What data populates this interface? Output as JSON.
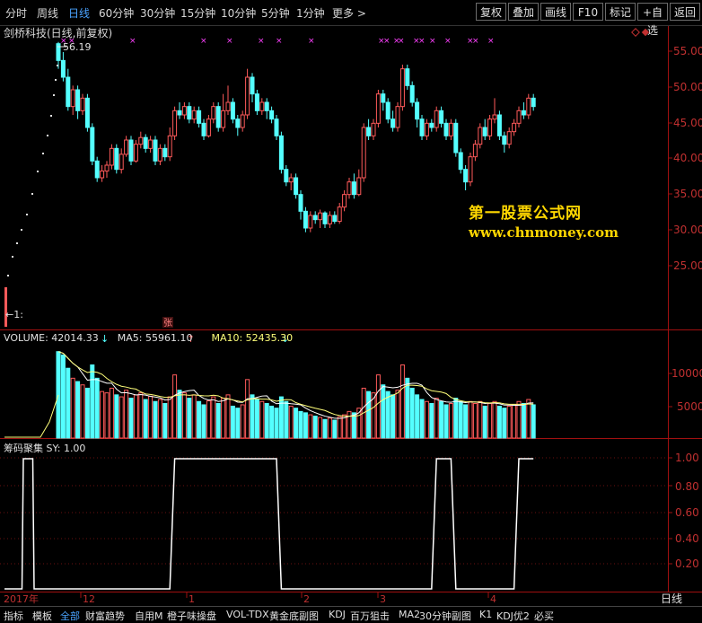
{
  "topbar": {
    "tabs": [
      "分时",
      "周线",
      "日线",
      "60分钟",
      "30分钟",
      "15分钟",
      "10分钟",
      "5分钟",
      "1分钟",
      "更多 >"
    ],
    "active_tab": "日线",
    "right_buttons": [
      "复权",
      "叠加",
      "画线",
      "F10",
      "标记",
      "+自选",
      "返回"
    ]
  },
  "stock": {
    "title": "剑桥科技(日线,前复权)",
    "peak_label": "56.19",
    "left_marker": "←1:",
    "bottom_marker": "张"
  },
  "watermark": {
    "line1": "第一股票公式网",
    "line2": "www.chnmoney.com"
  },
  "volume_header": {
    "label": "VOLUME: 42014.33",
    "ma5": "MA5: 55961.10",
    "ma10": "MA10: 52435.30"
  },
  "sy_header": {
    "label": "筹码聚集  SY: 1.00"
  },
  "price_axis": [
    "55.00",
    "50.00",
    "45.00",
    "40.00",
    "35.00",
    "30.00",
    "25.00"
  ],
  "volume_axis": [
    "10000",
    "5000"
  ],
  "sy_axis": [
    "1.00",
    "0.80",
    "0.60",
    "0.40",
    "0.20"
  ],
  "date_axis": [
    "2017年",
    "12",
    "1",
    "2",
    "3",
    "4"
  ],
  "period_label": "日线",
  "bottom_tabs": [
    "指标",
    "模板",
    "全部",
    "财富趋势",
    "自用M",
    "橙子味操盘",
    "VOL-TDX",
    "黄金底副图",
    "KDJ",
    "百万狙击",
    "MA2",
    "30分钟副图",
    "K1",
    "KDJ优2",
    "必买"
  ],
  "bottom_active": "全部",
  "colors": {
    "up": "#ff5a5a",
    "down": "#54ffff",
    "ma": "#ffffff",
    "ma10": "#ffff7a",
    "axis": "#a01010",
    "accent": "#4aa3ff",
    "magenta": "#ff40ff"
  },
  "chart_data": [
    {
      "type": "candlestick",
      "title": "剑桥科技(日线,前复权)",
      "ylim": [
        22,
        58
      ],
      "candles": [
        [
          56.0,
          54.0,
          56.2,
          53.0
        ],
        [
          54.0,
          52.0,
          55.0,
          51.5
        ],
        [
          52.0,
          48.5,
          53.0,
          48.0
        ],
        [
          48.5,
          50.5,
          51.0,
          47.5
        ],
        [
          50.5,
          48.0,
          51.0,
          47.0
        ],
        [
          48.0,
          49.5,
          50.0,
          47.5
        ],
        [
          49.5,
          46.0,
          50.0,
          45.5
        ],
        [
          46.0,
          42.0,
          46.5,
          41.5
        ],
        [
          42.0,
          40.0,
          42.5,
          39.5
        ],
        [
          40.0,
          40.8,
          41.5,
          39.5
        ],
        [
          40.8,
          41.5,
          42.0,
          40.0
        ],
        [
          41.5,
          43.5,
          44.0,
          41.0
        ],
        [
          43.5,
          41.0,
          44.0,
          40.5
        ],
        [
          41.0,
          42.8,
          43.5,
          40.5
        ],
        [
          42.8,
          44.5,
          45.0,
          42.5
        ],
        [
          44.5,
          42.0,
          45.0,
          41.5
        ],
        [
          42.0,
          44.0,
          44.5,
          41.8
        ],
        [
          44.0,
          44.8,
          45.5,
          43.5
        ],
        [
          44.8,
          43.5,
          45.2,
          43.0
        ],
        [
          43.5,
          44.5,
          45.0,
          43.0
        ],
        [
          44.5,
          42.0,
          45.0,
          41.5
        ],
        [
          42.0,
          43.5,
          44.0,
          41.5
        ],
        [
          43.5,
          42.5,
          44.0,
          42.0
        ],
        [
          42.5,
          45.0,
          46.0,
          42.0
        ],
        [
          45.0,
          48.0,
          48.5,
          44.5
        ],
        [
          48.0,
          47.5,
          49.0,
          47.0
        ],
        [
          47.5,
          48.5,
          49.0,
          47.0
        ],
        [
          48.5,
          47.0,
          49.0,
          46.5
        ],
        [
          47.0,
          48.0,
          48.5,
          46.5
        ],
        [
          48.0,
          46.5,
          48.5,
          46.0
        ],
        [
          46.5,
          45.0,
          47.0,
          44.5
        ],
        [
          45.0,
          47.0,
          47.5,
          44.8
        ],
        [
          47.0,
          48.5,
          49.0,
          46.5
        ],
        [
          48.5,
          46.0,
          49.0,
          45.5
        ],
        [
          46.0,
          48.0,
          50.0,
          45.5
        ],
        [
          48.0,
          49.0,
          51.0,
          47.5
        ],
        [
          49.0,
          47.0,
          49.5,
          46.5
        ],
        [
          47.0,
          46.0,
          47.5,
          45.0
        ],
        [
          46.0,
          47.5,
          48.0,
          45.5
        ],
        [
          47.5,
          52.0,
          53.0,
          47.0
        ],
        [
          52.0,
          50.0,
          52.5,
          49.0
        ],
        [
          50.0,
          48.0,
          50.5,
          47.5
        ],
        [
          48.0,
          49.0,
          49.5,
          47.5
        ],
        [
          49.0,
          48.0,
          49.5,
          47.0
        ],
        [
          48.0,
          47.0,
          48.5,
          46.5
        ],
        [
          47.0,
          45.0,
          47.5,
          44.5
        ],
        [
          45.0,
          41.0,
          45.5,
          40.5
        ],
        [
          41.0,
          39.5,
          41.5,
          39.0
        ],
        [
          39.5,
          40.0,
          40.5,
          38.5
        ],
        [
          40.0,
          38.0,
          40.5,
          37.5
        ],
        [
          38.0,
          36.0,
          38.5,
          35.0
        ],
        [
          36.0,
          34.0,
          36.5,
          33.5
        ],
        [
          34.0,
          35.5,
          36.0,
          33.5
        ],
        [
          35.5,
          35.0,
          36.0,
          34.5
        ],
        [
          35.0,
          35.8,
          36.2,
          34.0
        ],
        [
          35.8,
          34.5,
          36.0,
          34.0
        ],
        [
          34.5,
          35.5,
          36.0,
          34.0
        ],
        [
          35.5,
          34.8,
          36.0,
          34.5
        ],
        [
          34.8,
          36.5,
          37.0,
          34.5
        ],
        [
          36.5,
          38.0,
          38.5,
          36.0
        ],
        [
          38.0,
          39.5,
          40.0,
          37.5
        ],
        [
          39.5,
          38.0,
          40.5,
          37.5
        ],
        [
          38.0,
          40.0,
          41.0,
          37.8
        ],
        [
          40.0,
          46.0,
          46.5,
          39.5
        ],
        [
          46.0,
          45.0,
          47.0,
          44.5
        ],
        [
          45.0,
          46.5,
          47.0,
          44.5
        ],
        [
          46.5,
          50.0,
          50.5,
          46.0
        ],
        [
          50.0,
          49.0,
          50.5,
          48.0
        ],
        [
          49.0,
          47.0,
          49.5,
          46.5
        ],
        [
          47.0,
          46.0,
          48.0,
          45.5
        ],
        [
          46.0,
          48.5,
          49.0,
          45.5
        ],
        [
          48.5,
          53.0,
          53.5,
          48.0
        ],
        [
          53.0,
          51.0,
          53.5,
          50.5
        ],
        [
          51.0,
          49.0,
          51.5,
          48.5
        ],
        [
          49.0,
          47.0,
          49.5,
          46.0
        ],
        [
          47.0,
          45.0,
          47.5,
          44.5
        ],
        [
          45.0,
          46.5,
          47.0,
          44.5
        ],
        [
          46.5,
          46.0,
          47.0,
          45.5
        ],
        [
          46.0,
          48.0,
          48.5,
          45.5
        ],
        [
          48.0,
          46.5,
          48.5,
          46.0
        ],
        [
          46.5,
          45.0,
          47.0,
          44.5
        ],
        [
          45.0,
          46.5,
          47.0,
          44.5
        ],
        [
          46.5,
          43.0,
          47.0,
          42.5
        ],
        [
          43.0,
          41.0,
          43.5,
          40.5
        ],
        [
          41.0,
          39.5,
          41.5,
          38.5
        ],
        [
          39.5,
          42.5,
          43.0,
          39.0
        ],
        [
          42.5,
          44.0,
          44.5,
          42.0
        ],
        [
          44.0,
          46.0,
          46.5,
          43.5
        ],
        [
          46.0,
          45.0,
          47.0,
          44.5
        ],
        [
          45.0,
          47.0,
          47.5,
          44.5
        ],
        [
          47.0,
          47.5,
          49.5,
          46.5
        ],
        [
          47.5,
          45.0,
          48.0,
          44.5
        ],
        [
          45.0,
          44.0,
          45.5,
          43.0
        ],
        [
          44.0,
          45.5,
          46.0,
          43.5
        ],
        [
          45.5,
          46.5,
          47.0,
          45.0
        ],
        [
          46.5,
          48.0,
          48.5,
          46.0
        ],
        [
          48.0,
          47.5,
          49.0,
          47.0
        ],
        [
          47.5,
          49.5,
          50.0,
          47.0
        ],
        [
          49.5,
          48.5,
          50.0,
          48.0
        ]
      ]
    },
    {
      "type": "bar",
      "title": "VOLUME",
      "ylim": [
        0,
        13500
      ],
      "series": [
        {
          "name": "VOLUME",
          "values": [
            13000,
            12500,
            10500,
            9000,
            8500,
            8000,
            7500,
            11000,
            9000,
            7000,
            6800,
            7500,
            6500,
            6200,
            7200,
            6000,
            6500,
            6800,
            5800,
            6300,
            5500,
            5800,
            5200,
            6200,
            9500,
            7200,
            6800,
            6000,
            6500,
            5500,
            5000,
            5600,
            6200,
            5200,
            6000,
            6500,
            4800,
            4500,
            5000,
            8800,
            6500,
            5800,
            5500,
            5200,
            4800,
            4500,
            6200,
            5500,
            4800,
            4500,
            4000,
            3800,
            3500,
            3300,
            3100,
            2800,
            3000,
            2700,
            3200,
            3500,
            4000,
            3800,
            4500,
            7500,
            7000,
            6800,
            9500,
            8000,
            7000,
            6500,
            7200,
            11000,
            9000,
            7500,
            6500,
            5800,
            5500,
            5200,
            6000,
            5500,
            5000,
            5200,
            6000,
            5500,
            5000,
            5500,
            5200,
            5500,
            4800,
            5200,
            5500,
            4800,
            4500,
            4800,
            5000,
            5500,
            5200,
            5800,
            5000
          ]
        },
        {
          "name": "MA5",
          "values": []
        },
        {
          "name": "MA10",
          "values": []
        }
      ]
    },
    {
      "type": "line",
      "title": "筹码聚集",
      "ylim": [
        0.0,
        1.1
      ],
      "series": [
        {
          "name": "SY",
          "values": [
            0,
            0,
            0,
            0,
            0,
            0,
            0,
            0,
            0,
            0,
            0,
            0,
            0,
            0,
            0,
            0,
            0,
            0,
            0,
            0,
            0,
            0,
            0,
            0,
            1,
            1,
            1,
            1,
            1,
            1,
            1,
            1,
            1,
            1,
            1,
            1,
            1,
            1,
            1,
            1,
            1,
            1,
            1,
            1,
            1,
            1,
            0,
            0,
            0,
            0,
            0,
            0,
            0,
            0,
            0,
            0,
            0,
            0,
            0,
            0,
            0,
            0,
            0,
            0,
            0,
            0,
            0,
            0,
            0,
            0,
            0,
            0,
            0,
            0,
            0,
            0,
            0,
            0,
            1,
            1,
            1,
            1,
            0,
            0,
            0,
            0,
            0,
            0,
            0,
            0,
            0,
            0,
            0,
            0,
            0,
            1,
            1,
            1,
            1
          ]
        }
      ],
      "prefix_values": [
        0,
        0,
        0,
        0,
        0,
        0,
        0,
        0,
        0,
        0,
        0,
        0,
        0,
        0,
        1,
        1,
        1,
        1,
        1,
        1,
        1,
        1,
        0,
        0,
        0,
        0,
        0,
        0,
        0,
        0,
        0,
        0,
        0,
        0,
        0,
        0,
        0,
        0,
        0,
        0
      ]
    }
  ]
}
